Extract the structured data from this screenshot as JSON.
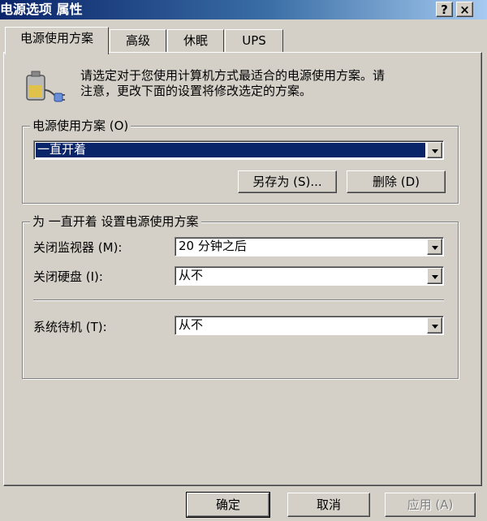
{
  "window": {
    "title": "电源选项 属性",
    "help_label": "?",
    "close_label": "×"
  },
  "tabs": [
    {
      "label": "电源使用方案",
      "active": true
    },
    {
      "label": "高级",
      "active": false
    },
    {
      "label": "休眠",
      "active": false
    },
    {
      "label": "UPS",
      "active": false
    }
  ],
  "description": {
    "line1": "请选定对于您使用计算机方式最适合的电源使用方案。请",
    "line2": "注意，更改下面的设置将修改选定的方案。",
    "icon": "power-plug-battery-icon"
  },
  "scheme_group": {
    "label": "电源使用方案 (O)",
    "selected": "一直开着",
    "save_as_label": "另存为 (S)...",
    "delete_label": "删除 (D)"
  },
  "settings_group": {
    "label": "为 一直开着 设置电源使用方案",
    "monitor_label": "关闭监视器 (M):",
    "monitor_value": "20 分钟之后",
    "disk_label": "关闭硬盘 (I):",
    "disk_value": "从不",
    "standby_label": "系统待机 (T):",
    "standby_value": "从不"
  },
  "footer": {
    "ok_label": "确定",
    "cancel_label": "取消",
    "apply_label": "应用 (A)"
  },
  "colors": {
    "face": "#d4d0c8",
    "title_start": "#0a246a",
    "title_end": "#a6caf0",
    "selection": "#0a246a"
  }
}
